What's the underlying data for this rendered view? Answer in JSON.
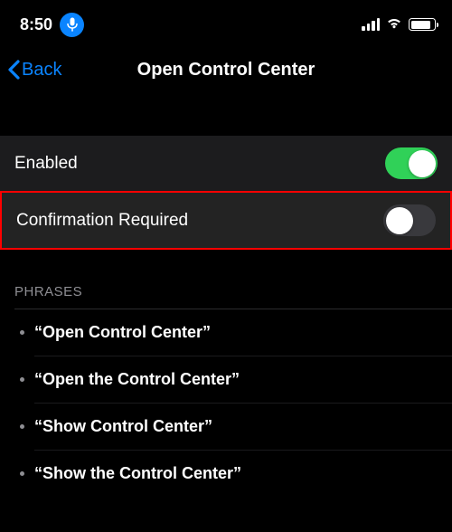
{
  "statusBar": {
    "time": "8:50"
  },
  "nav": {
    "back": "Back",
    "title": "Open Control Center"
  },
  "settings": {
    "enabled": {
      "label": "Enabled",
      "on": true
    },
    "confirmationRequired": {
      "label": "Confirmation Required",
      "on": false
    }
  },
  "phrases": {
    "header": "PHRASES",
    "items": [
      "“Open Control Center”",
      "“Open the Control Center”",
      "“Show Control Center”",
      "“Show the Control Center”"
    ]
  }
}
